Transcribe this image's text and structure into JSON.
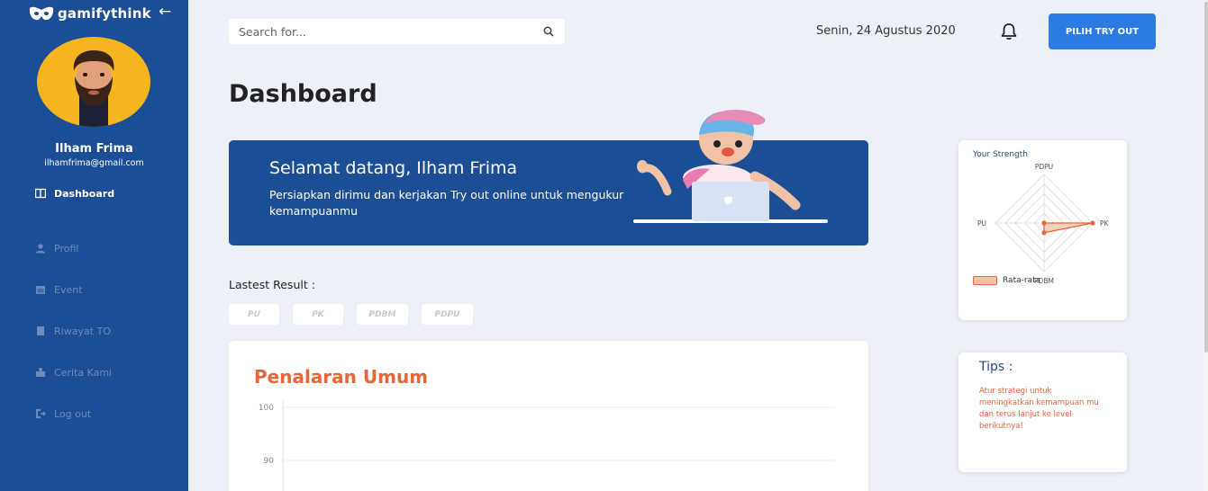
{
  "brand": {
    "name": "gamifythink"
  },
  "user": {
    "name": "Ilham Frima",
    "email": "ilhamfrima@gmail.com"
  },
  "sidebar": {
    "items": [
      {
        "label": "Dashboard",
        "icon": "dashboard-icon",
        "active": true
      },
      {
        "label": "Profil",
        "icon": "user-icon"
      },
      {
        "label": "Event",
        "icon": "calendar-icon"
      },
      {
        "label": "Riwayat TO",
        "icon": "document-icon"
      },
      {
        "label": "Cerita Kami",
        "icon": "story-icon"
      },
      {
        "label": "Log out",
        "icon": "logout-icon"
      }
    ]
  },
  "search": {
    "placeholder": "Search for..."
  },
  "header": {
    "date": "Senin, 24 Agustus 2020",
    "try_out_button": "PILIH TRY OUT"
  },
  "page": {
    "title": "Dashboard"
  },
  "welcome": {
    "title": "Selamat datang, Ilham Frima",
    "subtitle": "Persiapkan dirimu dan kerjakan Try out online untuk mengukur kemampuanmu"
  },
  "latest": {
    "label": "Lastest Result :",
    "chips": [
      "PU",
      "PK",
      "PDBM",
      "PDPU"
    ]
  },
  "chart_card": {
    "title": "Penalaran Umum"
  },
  "chart_data": {
    "type": "line",
    "title": "Penalaran Umum",
    "ytick_labels": [
      "100",
      "90"
    ],
    "ylim": [
      80,
      100
    ],
    "series": []
  },
  "strength": {
    "title": "Your Strength",
    "axes": [
      "PDPU",
      "PK",
      "PDBM",
      "PU"
    ],
    "series_name": "Rata-rata",
    "values": [
      0,
      100,
      20,
      0
    ],
    "max": 100
  },
  "tips": {
    "title": "Tips :",
    "text": "Atur strategi untuk meningkatkan kemampuan mu dan terus lanjut ke level berikutnya!"
  },
  "colors": {
    "sidebar": "#1c4e96",
    "accent": "#2c7be5",
    "orange": "#e8663a",
    "avatar_bg": "#f5b51e"
  }
}
